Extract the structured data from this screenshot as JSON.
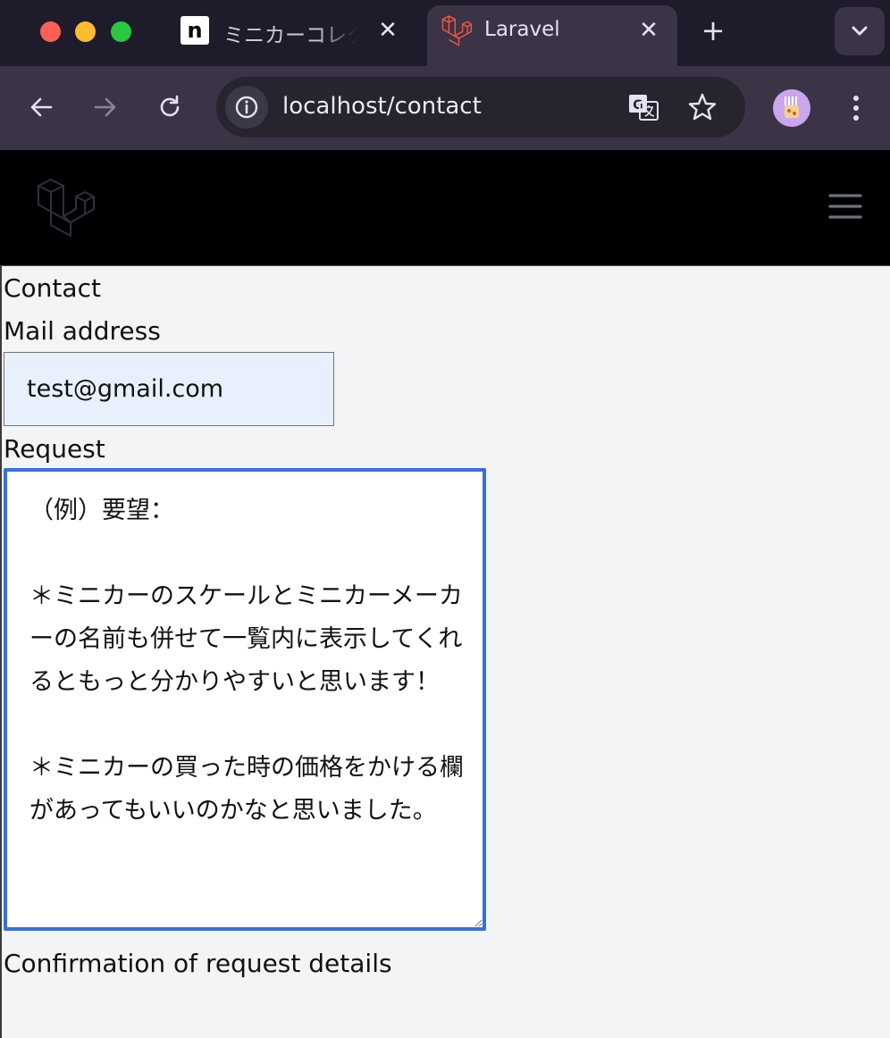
{
  "browser": {
    "tabs": [
      {
        "title": "ミニカーコレクション",
        "active": false,
        "favicon": "notion-n-icon"
      },
      {
        "title": "Laravel",
        "active": true,
        "favicon": "laravel-icon"
      }
    ],
    "favicon_letter": "n",
    "close_glyph": "✕",
    "new_tab_glyph": "+",
    "url": "localhost/contact"
  },
  "page": {
    "title": "Contact",
    "mail_label": "Mail address",
    "mail_value": "test@gmail.com",
    "request_label": "Request",
    "request_value": "（例）要望：\n\n＊ミニカーのスケールとミニカーメーカーの名前も併せて一覧内に表示してくれるともっと分かりやすいと思います！\n\n＊ミニカーの買った時の価格をかける欄があってもいいのかなと思いました。",
    "confirm_label": "Confirmation of request details"
  },
  "colors": {
    "tabstrip": "#1e1b2b",
    "toolbar": "#3a3446",
    "omnibox": "#27232f",
    "header": "#000000",
    "page_bg": "#f3f4f6",
    "autofill_bg": "#e8f0fe",
    "focus_border": "#3b6fd8",
    "laravel_red": "#f05340"
  }
}
